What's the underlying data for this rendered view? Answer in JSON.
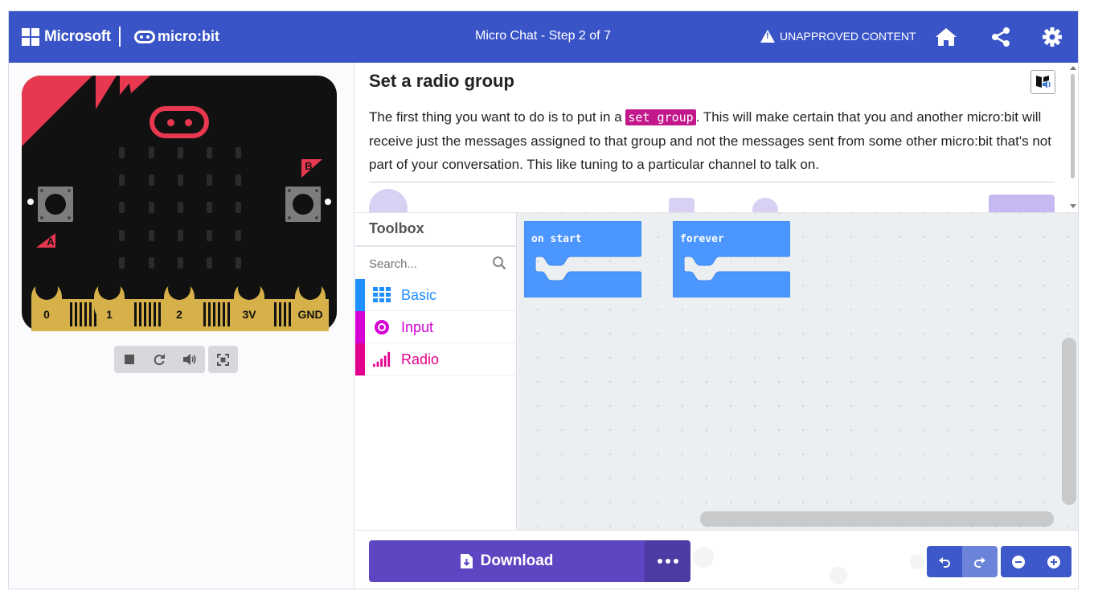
{
  "header": {
    "brand": "Microsoft",
    "product": "micro:bit",
    "title": "Micro Chat  -  Step 2 of 7",
    "warning": "UNAPPROVED CONTENT",
    "icons": [
      "home-icon",
      "share-icon",
      "settings-gear-icon"
    ]
  },
  "simulator": {
    "button_a": "A",
    "button_b": "B",
    "pins": [
      "0",
      "1",
      "2",
      "3V",
      "GND"
    ],
    "controls": [
      "stop-icon",
      "restart-icon",
      "sound-icon",
      "fullscreen-icon"
    ]
  },
  "tutorial": {
    "title": "Set a radio group",
    "text_before": "The first thing you want to do is to put in a ",
    "code": "set group",
    "text_after": ". This will make certain that you and another micro:bit will receive just the messages assigned to that group and not the messages sent from some other micro:bit that's not part of your conversation. This like tuning to a particular channel to talk on."
  },
  "toolbox": {
    "title": "Toolbox",
    "search_placeholder": "Search...",
    "categories": [
      {
        "label": "Basic",
        "color": "#1e90ff",
        "icon": "grid-icon"
      },
      {
        "label": "Input",
        "color": "#d400d4",
        "icon": "circle-target-icon"
      },
      {
        "label": "Radio",
        "color": "#e3008c",
        "icon": "signal-bars-icon"
      }
    ]
  },
  "workspace": {
    "blocks": [
      {
        "label": "on start",
        "color": "#4c97ff"
      },
      {
        "label": "forever",
        "color": "#4c97ff"
      }
    ]
  },
  "footer": {
    "download_label": "Download",
    "more_icon": "more-dots-icon",
    "edit_icons": [
      "undo-icon",
      "redo-icon",
      "zoom-out-icon",
      "zoom-in-icon"
    ]
  },
  "colors": {
    "header_bg": "#3954c7",
    "download_bg": "#5e45c2",
    "code_bg": "#c2188c",
    "board_accent": "#e8384f",
    "pin_gold": "#d6b048"
  }
}
